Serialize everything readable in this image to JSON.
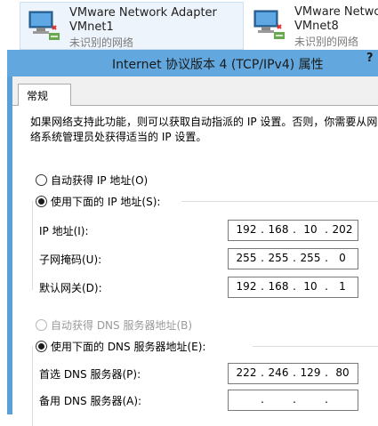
{
  "adapters": [
    {
      "name": "VMware Network Adapter",
      "sub": "VMnet1",
      "status": "未识别的网络"
    },
    {
      "name": "VMware Networ",
      "sub": "VMnet8",
      "status": "未识别的网络"
    }
  ],
  "dialog": {
    "title": "Internet 协议版本 4 (TCP/IPv4) 属性",
    "help_label": "?",
    "tab_label": "常规",
    "description": [
      "如果网络支持此功能，则可以获取自动指派的 IP 设置。否则，你需要从网",
      "络系统管理员处获得适当的 IP 设置。"
    ],
    "ip_auto_label": "自动获得 IP 地址(O)",
    "ip_manual_label": "使用下面的 IP 地址(S):",
    "ip_fields": [
      {
        "label": "IP 地址(I):",
        "octets": [
          "192",
          "168",
          "10",
          "202"
        ]
      },
      {
        "label": "子网掩码(U):",
        "octets": [
          "255",
          "255",
          "255",
          "0"
        ]
      },
      {
        "label": "默认网关(D):",
        "octets": [
          "192",
          "168",
          "10",
          "1"
        ]
      }
    ],
    "dns_auto_label": "自动获得 DNS 服务器地址(B)",
    "dns_manual_label": "使用下面的 DNS 服务器地址(E):",
    "dns_fields": [
      {
        "label": "首选 DNS 服务器(P):",
        "octets": [
          "222",
          "246",
          "129",
          "80"
        ]
      },
      {
        "label": "备用 DNS 服务器(A):",
        "octets": [
          "",
          "",
          "",
          ""
        ]
      }
    ],
    "dot": "."
  }
}
